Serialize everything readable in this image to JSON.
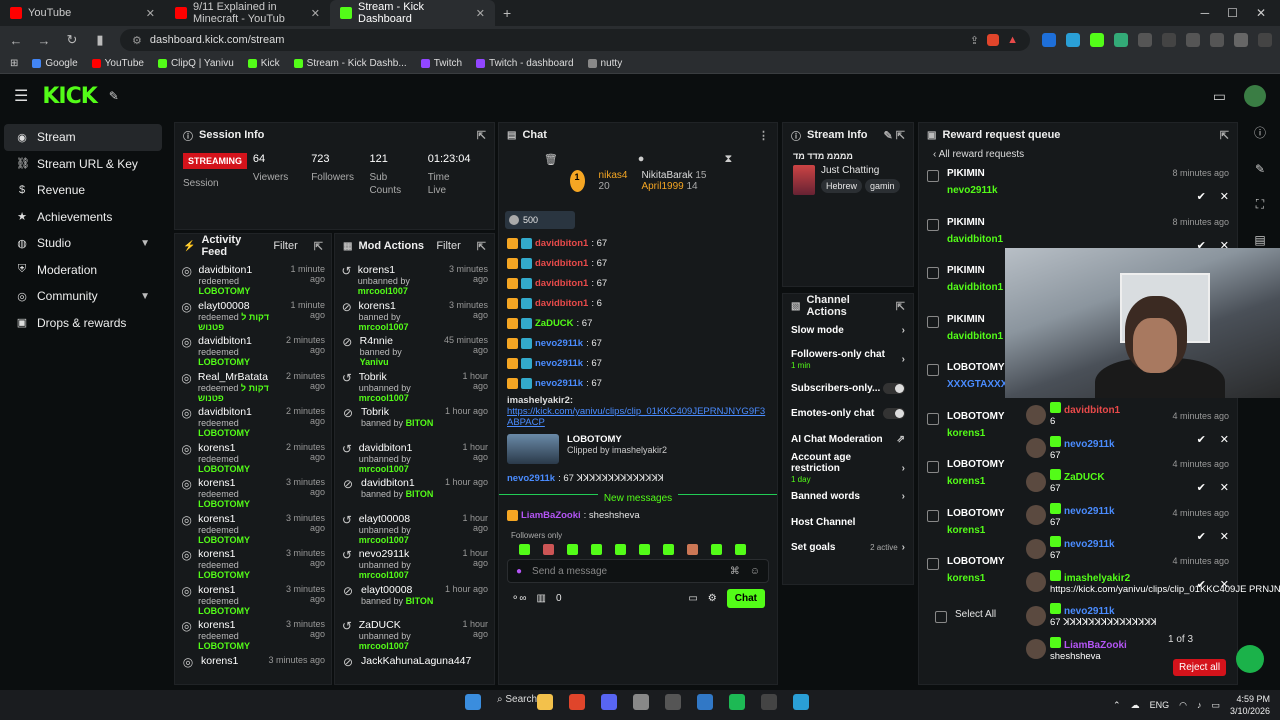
{
  "browser": {
    "tabs": [
      {
        "title": "YouTube",
        "color": "#ff0000"
      },
      {
        "title": "9/11 Explained in Minecraft - YouTub",
        "color": "#ff0000"
      },
      {
        "title": "Stream - Kick Dashboard",
        "color": "#53fc18",
        "active": true
      }
    ],
    "url": "dashboard.kick.com/stream",
    "bookmarks": [
      {
        "label": "Google",
        "color": "#4285f4"
      },
      {
        "label": "YouTube",
        "color": "#ff0000"
      },
      {
        "label": "ClipQ | Yanivu",
        "color": "#53fc18"
      },
      {
        "label": "Kick",
        "color": "#53fc18"
      },
      {
        "label": "Stream - Kick Dashb...",
        "color": "#53fc18"
      },
      {
        "label": "Twitch",
        "color": "#9146ff"
      },
      {
        "label": "Twitch - dashboard",
        "color": "#9146ff"
      },
      {
        "label": "nutty",
        "color": "#888888"
      }
    ]
  },
  "brand": {
    "logo": "KICK",
    "accent": "#53fc18"
  },
  "sidebar": {
    "items": [
      {
        "label": "Stream",
        "icon": "broadcast-icon",
        "active": true
      },
      {
        "label": "Stream URL & Key",
        "icon": "link-icon"
      },
      {
        "label": "Revenue",
        "icon": "dollar-icon"
      },
      {
        "label": "Achievements",
        "icon": "star-icon"
      },
      {
        "label": "Studio",
        "icon": "palette-icon",
        "chevron": true
      },
      {
        "label": "Moderation",
        "icon": "shield-icon"
      },
      {
        "label": "Community",
        "icon": "globe-icon",
        "chevron": true
      },
      {
        "label": "Drops & rewards",
        "icon": "gift-icon"
      }
    ]
  },
  "session": {
    "title": "Session Info",
    "status": "STREAMING",
    "status_label": "Session",
    "viewers": "64",
    "viewers_label": "Viewers",
    "followers": "723",
    "followers_label": "Followers",
    "subs": "121",
    "subs_label": "Sub Counts",
    "time": "01:23:04",
    "time_label": "Time Live"
  },
  "activity": {
    "title": "Activity Feed",
    "filter": "Filter",
    "rows": [
      {
        "user": "davidbiton1",
        "time": "1 minute ago",
        "prefix": "redeemed",
        "reward": "LOBOTOMY"
      },
      {
        "user": "elayt00008",
        "time": "1 minute ago",
        "prefix": "redeemed",
        "reward": "דקות ל פטנוש"
      },
      {
        "user": "davidbiton1",
        "time": "2 minutes ago",
        "prefix": "redeemed",
        "reward": "LOBOTOMY"
      },
      {
        "user": "Real_MrBatata",
        "time": "2 minutes ago",
        "prefix": "redeemed",
        "reward": "דקות ל פטנוש"
      },
      {
        "user": "davidbiton1",
        "time": "2 minutes ago",
        "prefix": "redeemed",
        "reward": "LOBOTOMY"
      },
      {
        "user": "korens1",
        "time": "2 minutes ago",
        "prefix": "redeemed",
        "reward": "LOBOTOMY"
      },
      {
        "user": "korens1",
        "time": "3 minutes ago",
        "prefix": "redeemed",
        "reward": "LOBOTOMY"
      },
      {
        "user": "korens1",
        "time": "3 minutes ago",
        "prefix": "redeemed",
        "reward": "LOBOTOMY"
      },
      {
        "user": "korens1",
        "time": "3 minutes ago",
        "prefix": "redeemed",
        "reward": "LOBOTOMY"
      },
      {
        "user": "korens1",
        "time": "3 minutes ago",
        "prefix": "redeemed",
        "reward": "LOBOTOMY"
      },
      {
        "user": "korens1",
        "time": "3 minutes ago",
        "prefix": "redeemed",
        "reward": "LOBOTOMY"
      },
      {
        "user": "korens1",
        "time": "3 minutes ago",
        "prefix": "",
        "reward": ""
      }
    ]
  },
  "mod": {
    "title": "Mod Actions",
    "filter": "Filter",
    "rows": [
      {
        "user": "korens1",
        "time": "3 minutes ago",
        "action": "unbanned by",
        "by": "mrcool1007"
      },
      {
        "user": "korens1",
        "time": "3 minutes ago",
        "action": "banned by",
        "by": "mrcool1007"
      },
      {
        "user": "R4nnie",
        "time": "45 minutes ago",
        "action": "banned by",
        "by": "Yanivu"
      },
      {
        "user": "Tobrik",
        "time": "1 hour ago",
        "action": "unbanned by",
        "by": "mrcool1007"
      },
      {
        "user": "Tobrik",
        "time": "1 hour ago",
        "action": "banned by",
        "by": "BITON"
      },
      {
        "user": "davidbiton1",
        "time": "1 hour ago",
        "action": "unbanned by",
        "by": "mrcool1007"
      },
      {
        "user": "davidbiton1",
        "time": "1 hour ago",
        "action": "banned by",
        "by": "BITON"
      },
      {
        "user": "elayt00008",
        "time": "1 hour ago",
        "action": "unbanned by",
        "by": "mrcool1007"
      },
      {
        "user": "nevo2911k",
        "time": "1 hour ago",
        "action": "unbanned by",
        "by": "mrcool1007"
      },
      {
        "user": "elayt00008",
        "time": "1 hour ago",
        "action": "banned by",
        "by": "BITON"
      },
      {
        "user": "ZaDUCK",
        "time": "1 hour ago",
        "action": "unbanned by",
        "by": "mrcool1007"
      },
      {
        "user": "JackKahunaLaguna447",
        "time": "",
        "action": "",
        "by": ""
      }
    ]
  },
  "chat": {
    "title": "Chat",
    "gifters": [
      {
        "name": "nikas4",
        "count": "20"
      },
      {
        "name": "NikitaBarak",
        "count": "15"
      },
      {
        "name": "April1999",
        "count": "14"
      }
    ],
    "goal": "500",
    "messages": [
      {
        "user": "davidbiton1",
        "text": ": 67",
        "color": "#e84a4a"
      },
      {
        "user": "davidbiton1",
        "text": ": 67",
        "color": "#e84a4a"
      },
      {
        "user": "davidbiton1",
        "text": ": 67",
        "color": "#e84a4a"
      },
      {
        "user": "davidbiton1",
        "text": ": 6",
        "color": "#e84a4a"
      },
      {
        "user": "ZaDUCK",
        "text": ": 67",
        "color": "#53fc18"
      },
      {
        "user": "nevo2911k",
        "text": ": 67",
        "color": "#4a8cff"
      },
      {
        "user": "nevo2911k",
        "text": ": 67",
        "color": "#4a8cff"
      },
      {
        "user": "nevo2911k",
        "text": ": 67",
        "color": "#4a8cff"
      }
    ],
    "link_user": "imashelyakir2:",
    "link": "https://kick.com/yanivu/clips/clip_01KKC409JEPRNJNYG9F3ABPACP",
    "clip_title": "LOBOTOMY",
    "clip_by": "Clipped by imashelyakir2",
    "last_user": "nevo2911k",
    "last_text": ": 67 ꓘꓘꓘꓘꓘꓘꓘꓘꓘꓘꓘꓘꓘꓘ",
    "new_messages": "New messages",
    "latest_user": "LiamBaZooki",
    "latest_text": ": sheshsheva",
    "followers_only": "Followers only",
    "placeholder": "Send a message",
    "points": "0",
    "send": "Chat"
  },
  "stream_info": {
    "title": "Stream Info",
    "stream_title": "ממממ מדד מד",
    "category": "Just Chatting",
    "tags": [
      "Hebrew",
      "gamin"
    ]
  },
  "channel_actions": {
    "title": "Channel Actions",
    "rows": [
      {
        "label": "Slow mode",
        "type": "arrow"
      },
      {
        "label": "Followers-only chat",
        "sub": "1 min",
        "type": "arrow"
      },
      {
        "label": "Subscribers-only...",
        "type": "toggle"
      },
      {
        "label": "Emotes-only chat",
        "type": "toggle"
      },
      {
        "label": "AI Chat Moderation",
        "type": "ext"
      },
      {
        "label": "Account age restriction",
        "sub": "1 day",
        "type": "arrow"
      },
      {
        "label": "Banned words",
        "type": "arrow"
      },
      {
        "label": "Host Channel",
        "type": "none"
      },
      {
        "label": "Set goals",
        "extra": "2 active",
        "type": "arrow"
      }
    ]
  },
  "rewards": {
    "title": "Reward request queue",
    "back": "All reward requests",
    "rows": [
      {
        "reward": "PIKIMIN",
        "user": "nevo2911k",
        "time": "8 minutes ago"
      },
      {
        "reward": "PIKIMIN",
        "user": "davidbiton1",
        "time": "8 minutes ago"
      },
      {
        "reward": "PIKIMIN",
        "user": "davidbiton1",
        "time": ""
      },
      {
        "reward": "PIKIMIN",
        "user": "davidbiton1",
        "time": ""
      },
      {
        "reward": "LOBOTOMY",
        "user": "XXXGTAXXX",
        "time": ""
      },
      {
        "reward": "LOBOTOMY",
        "user": "korens1",
        "time": "4 minutes ago"
      },
      {
        "reward": "LOBOTOMY",
        "user": "korens1",
        "time": "4 minutes ago"
      },
      {
        "reward": "LOBOTOMY",
        "user": "korens1",
        "time": "4 minutes ago"
      },
      {
        "reward": "LOBOTOMY",
        "user": "korens1",
        "time": "4 minutes ago"
      }
    ],
    "select_all": "Select All",
    "pager": "1 of 3",
    "reject_all": "Reject all"
  },
  "overlay_chat": [
    {
      "user": "davidbiton1",
      "text": "6",
      "color": "#e84a4a"
    },
    {
      "user": "nevo2911k",
      "text": "67",
      "color": "#4a8cff"
    },
    {
      "user": "ZaDUCK",
      "text": "67",
      "color": "#53fc18"
    },
    {
      "user": "nevo2911k",
      "text": "67",
      "color": "#4a8cff"
    },
    {
      "user": "nevo2911k",
      "text": "67",
      "color": "#4a8cff"
    },
    {
      "user": "imashelyakir2",
      "text": "https://kick.com/yanivu/clips/clip_01KKC409JE PRNJNYG9F3ABPACP",
      "color": "#53fc18"
    },
    {
      "user": "nevo2911k",
      "text": "67 ꓘꓘꓘꓘꓘꓘꓘꓘꓘꓘꓘꓘꓘꓘꓘ",
      "color": "#4a8cff"
    },
    {
      "user": "LiamBaZooki",
      "text": "sheshsheva",
      "color": "#b455f5"
    }
  ],
  "taskbar": {
    "search": "Search",
    "lang": "ENG",
    "time": "4:59 PM",
    "date": "3/10/2026"
  }
}
